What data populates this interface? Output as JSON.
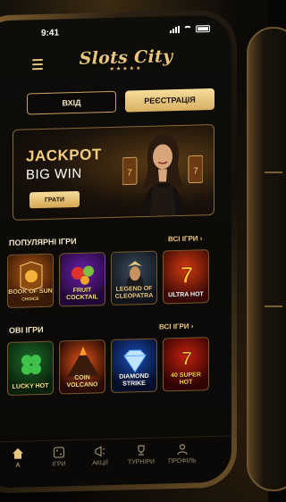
{
  "status": {
    "time": "9:41"
  },
  "logo": {
    "name": "Slots City",
    "stars": "★★★★★"
  },
  "auth": {
    "login": "ВХІД",
    "register": "РЕЄСТРАЦІЯ"
  },
  "banner": {
    "title": "JACKPOT",
    "subtitle": "BIG WIN",
    "play": "ГРАТИ"
  },
  "popular": {
    "title": "ПОПУЛЯРНІ ІГРИ",
    "link": "ВСІ ІГРИ ›",
    "games": [
      {
        "name": "BOOK OF SUN",
        "sub": "CHOICE"
      },
      {
        "name": "FRUIT COCKTAIL"
      },
      {
        "name": "LEGEND OF CLEOPATRA"
      },
      {
        "name": "ULTRA HOT"
      }
    ]
  },
  "new_games": {
    "title": "ОВІ ІГРИ",
    "link": "ВСІ ІГРИ ›",
    "games": [
      {
        "name": "LUCKY HOT"
      },
      {
        "name": "COIN VOLCANO"
      },
      {
        "name": "DIAMOND STRIKE"
      },
      {
        "name": "40 SUPER HOT"
      }
    ]
  },
  "tabs": [
    {
      "label": "А",
      "icon": "home-icon",
      "active": true
    },
    {
      "label": "ІГРИ",
      "icon": "dice-icon"
    },
    {
      "label": "АКЦІЇ",
      "icon": "megaphone-icon"
    },
    {
      "label": "ТУРНІРИ",
      "icon": "trophy-icon"
    },
    {
      "label": "ПРОФІЛЬ",
      "icon": "user-icon"
    }
  ],
  "colors": {
    "gold": "#e8c67c",
    "gold_btn": "#d9b062",
    "bg": "#0a0907"
  }
}
